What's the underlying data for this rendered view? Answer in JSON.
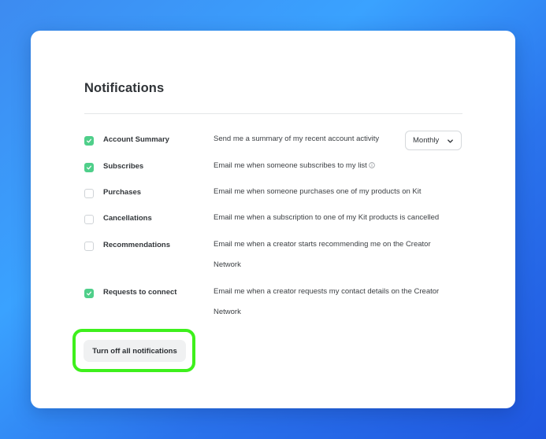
{
  "settings": {
    "title": "Notifications",
    "frequency_select": {
      "selected": "Monthly"
    },
    "rows": [
      {
        "label": "Account Summary",
        "description": "Send me a summary of my recent account activity",
        "checked": true
      },
      {
        "label": "Subscribes",
        "description": "Email me when someone subscribes to my list",
        "checked": true
      },
      {
        "label": "Purchases",
        "description": "Email me when someone purchases one of my products on Kit",
        "checked": false
      },
      {
        "label": "Cancellations",
        "description": "Email me when a subscription to one of my Kit products is cancelled",
        "checked": false
      },
      {
        "label": "Recommendations",
        "description": "Email me when a creator starts recommending me on the Creator Network",
        "checked": false
      },
      {
        "label": "Requests to connect",
        "description": "Email me when a creator requests my contact details on the Creator Network",
        "checked": true
      }
    ],
    "turn_off_button": "Turn off all notifications"
  },
  "colors": {
    "checkbox_checked": "#4fcf8a",
    "highlight_outline": "#3ef01c",
    "background_gradient_start": "#3aa2ff",
    "background_gradient_end": "#1f57e0"
  },
  "icons": {
    "check": "check-icon",
    "info": "info-icon",
    "dropdown": "chevron-down-icon"
  }
}
